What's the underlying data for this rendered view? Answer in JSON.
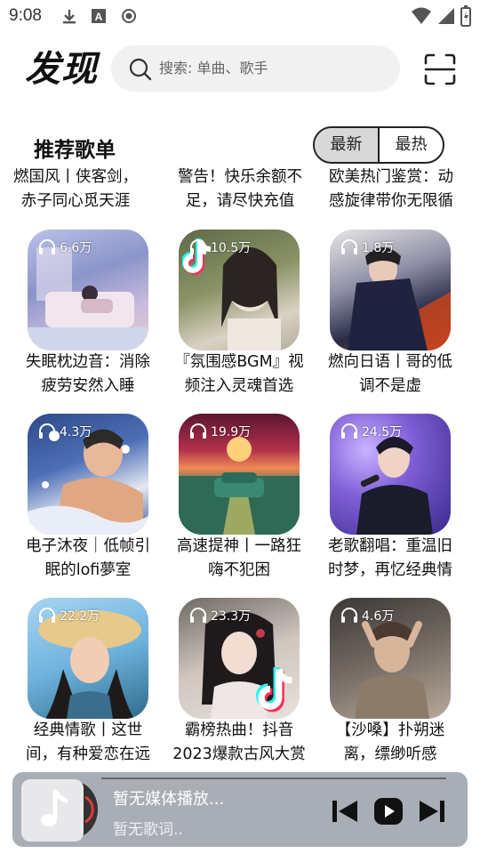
{
  "status_bar": {
    "time": "9:08"
  },
  "header": {
    "title": "发现",
    "search_placeholder": "搜索: 单曲、歌手"
  },
  "section": {
    "title": "推荐歌单",
    "tabs": [
      "最新",
      "最热"
    ]
  },
  "clipped_row": [
    {
      "title": [
        "燃国风丨侠客剑，",
        "赤子同心觅天涯"
      ]
    },
    {
      "title": [
        "警告！快乐余额不",
        "足，请尽快充值"
      ]
    },
    {
      "title": [
        "欧美热门鉴赏：动",
        "感旋律带你无限循"
      ]
    }
  ],
  "playlists": [
    {
      "plays": "6.6万",
      "title": [
        "失眠枕边音：消除",
        "疲劳安然入睡"
      ]
    },
    {
      "plays": "10.5万",
      "title": [
        "『氛围感BGM』视",
        "频注入灵魂首选"
      ]
    },
    {
      "plays": "1.8万",
      "title": [
        "燃向日语丨哥的低",
        "调不是虚"
      ]
    },
    {
      "plays": "4.3万",
      "title": [
        "电子沐夜｜低帧引",
        "眠的lofi夢室"
      ]
    },
    {
      "plays": "19.9万",
      "title": [
        "高速提神丨一路狂",
        "嗨不犯困"
      ]
    },
    {
      "plays": "24.5万",
      "title": [
        "老歌翻唱：重温旧",
        "时梦，再忆经典情"
      ]
    },
    {
      "plays": "22.2万",
      "title": [
        "经典情歌丨这世",
        "间，有种爱恋在远"
      ]
    },
    {
      "plays": "23.3万",
      "title": [
        "霸榜热曲！抖音",
        "2023爆款古风大赏"
      ]
    },
    {
      "plays": "4.6万",
      "title": [
        "【沙嗓】扑朔迷",
        "离，缥缈听感"
      ]
    }
  ],
  "player": {
    "title": "暂无媒体播放...",
    "lyric": "暂无歌词.."
  },
  "colors": {
    "player_bg": "#a9adb5",
    "search_bg": "#f1f1f1"
  }
}
